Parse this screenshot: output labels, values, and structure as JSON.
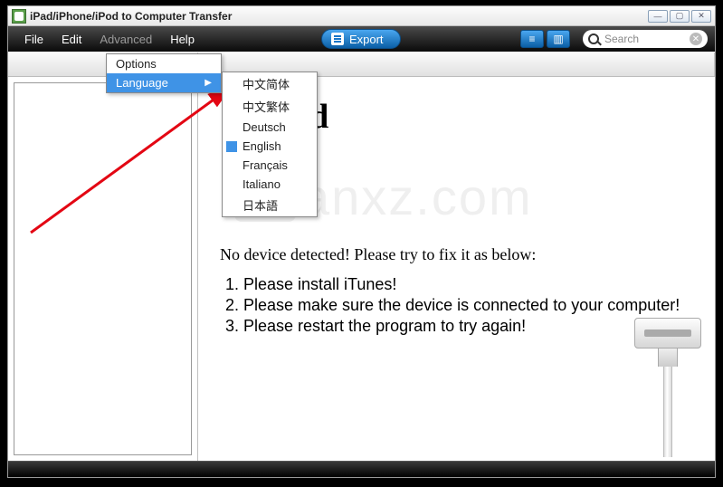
{
  "window": {
    "title": "iPad/iPhone/iPod to Computer Transfer"
  },
  "menubar": {
    "file": "File",
    "edit": "Edit",
    "advanced": "Advanced",
    "help": "Help",
    "export": "Export",
    "search_placeholder": "Search"
  },
  "advanced_menu": {
    "options": "Options",
    "language": "Language"
  },
  "language_menu": {
    "items": {
      "0": "中文简体",
      "1": "中文繁体",
      "2": "Deutsch",
      "3": "English",
      "4": "Français",
      "5": "Italiano",
      "6": "日本語"
    },
    "selected_index": 3
  },
  "content": {
    "heading_full": "Getting Started",
    "heading_visible": " Started",
    "no_device": "No device detected! Please try to fix it as below:",
    "steps": {
      "0": "Please install iTunes!",
      "1": "Please make sure the device is connected to your computer!",
      "2": "Please restart the program to try again!"
    }
  },
  "watermark": {
    "text": "anxz.com"
  }
}
